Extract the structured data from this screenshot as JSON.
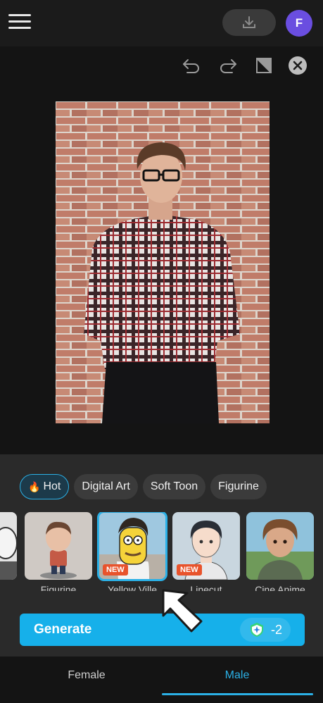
{
  "header": {
    "avatar_initial": "F",
    "icons": [
      "menu-icon",
      "download-icon"
    ]
  },
  "toolbar": {
    "icons": [
      "undo-icon",
      "redo-icon",
      "erase-icon",
      "close-icon"
    ]
  },
  "categories": [
    {
      "label": "Hot",
      "icon": "fire-icon",
      "active": true
    },
    {
      "label": "Digital Art",
      "active": false
    },
    {
      "label": "Soft Toon",
      "active": false
    },
    {
      "label": "Figurine",
      "active": false
    }
  ],
  "styles": [
    {
      "label": "",
      "new": false,
      "selected": false
    },
    {
      "label": "Figurine",
      "new": false,
      "selected": false
    },
    {
      "label": "Yellow Ville",
      "new": true,
      "new_label": "NEW",
      "selected": true
    },
    {
      "label": "Linecut",
      "new": true,
      "new_label": "NEW",
      "selected": false
    },
    {
      "label": "Cine Anime",
      "new": false,
      "selected": false
    }
  ],
  "generate": {
    "label": "Generate",
    "cost": "-2"
  },
  "gender_tabs": [
    {
      "label": "Female",
      "active": false
    },
    {
      "label": "Male",
      "active": true
    }
  ],
  "colors": {
    "accent": "#16b0ea",
    "avatar": "#6a4ee0",
    "new_badge": "#e8532c"
  }
}
